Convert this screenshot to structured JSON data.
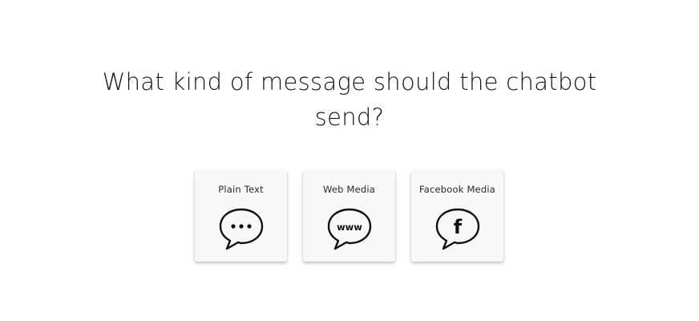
{
  "question": {
    "line1": "What kind of message should the chatbot",
    "line2": "send?"
  },
  "options": [
    {
      "label": "Plain Text",
      "icon": "speech-bubble-ellipsis-icon"
    },
    {
      "label": "Web Media",
      "icon": "speech-bubble-www-icon"
    },
    {
      "label": "Facebook Media",
      "icon": "speech-bubble-facebook-icon"
    }
  ],
  "icon_text": {
    "www": "www",
    "facebook": "f"
  },
  "colors": {
    "background": "#ffffff",
    "card": "#f8f8f8",
    "text": "#161616",
    "icon_stroke": "#111111"
  }
}
